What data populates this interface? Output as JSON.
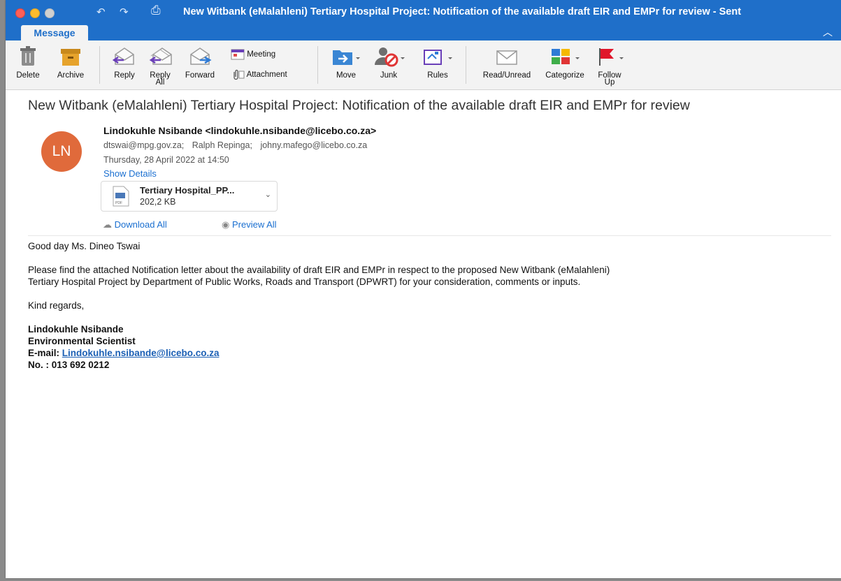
{
  "window": {
    "title": "New Witbank (eMalahleni) Tertiary Hospital Project: Notification of the available draft EIR and EMPr for review - Sent",
    "tab_label": "Message"
  },
  "ribbon": {
    "delete": "Delete",
    "archive": "Archive",
    "reply": "Reply",
    "reply_all_line1": "Reply",
    "reply_all_line2": "All",
    "forward": "Forward",
    "meeting": "Meeting",
    "attachment": "Attachment",
    "move": "Move",
    "junk": "Junk",
    "rules": "Rules",
    "read_unread": "Read/Unread",
    "categorize": "Categorize",
    "follow_up_line1": "Follow",
    "follow_up_line2": "Up"
  },
  "message": {
    "subject": "New Witbank (eMalahleni) Tertiary Hospital Project: Notification of the available draft EIR and EMPr for review",
    "avatar_initials": "LN",
    "from": "Lindokuhle Nsibande <lindokuhle.nsibande@licebo.co.za>",
    "to": [
      "dtswai@mpg.gov.za;",
      "Ralph Repinga;",
      "johny.mafego@licebo.co.za"
    ],
    "date": "Thursday, 28 April 2022 at 14:50",
    "show_details": "Show Details",
    "attachment": {
      "name": "Tertiary Hospital_PP...",
      "size": "202,2 KB",
      "file_type": "PDF"
    },
    "download_all": "Download All",
    "preview_all": "Preview All"
  },
  "body": {
    "greeting": "Good day Ms. Dineo Tswai",
    "paragraph_line1": "Please find the attached Notification letter about the availability of draft EIR and EMPr in respect to the proposed New Witbank (eMalahleni)",
    "paragraph_line2": "Tertiary Hospital Project by Department of Public Works, Roads and Transport (DPWRT) for your consideration, comments or inputs.",
    "closing": "Kind regards,",
    "signature_name": "Lindokuhle Nsibande",
    "signature_title": "Environmental Scientist",
    "email_label": "E-mail:",
    "email_value": "Lindokuhle.nsibande@licebo.co.za",
    "phone": "No. : 013 692 0212"
  },
  "colors": {
    "titlebar": "#1f6fc9",
    "avatar": "#e06a3b",
    "link": "#1a6fd0"
  }
}
